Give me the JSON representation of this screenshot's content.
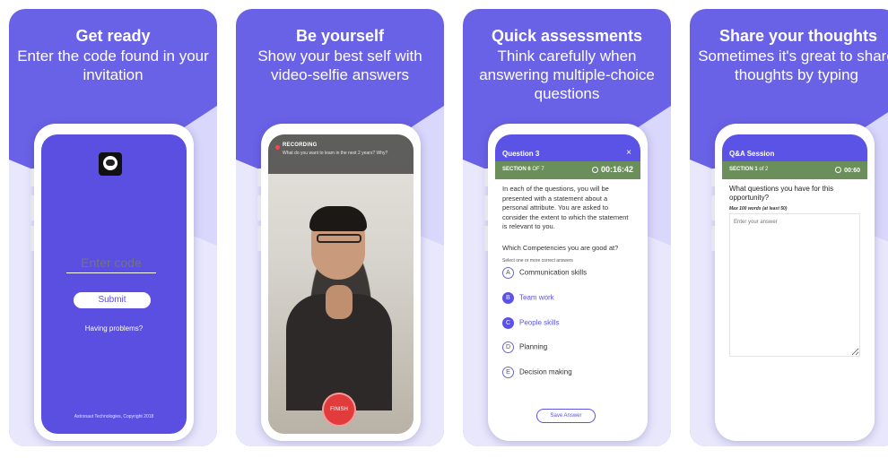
{
  "panels": [
    {
      "title": "Get ready",
      "subtitle": "Enter the code found in your invitation"
    },
    {
      "title": "Be yourself",
      "subtitle": "Show your best self with video-selfie answers"
    },
    {
      "title": "Quick assessments",
      "subtitle": "Think carefully when answering multiple-choice questions"
    },
    {
      "title": "Share your thoughts",
      "subtitle": "Sometimes it's great to share thoughts by typing"
    }
  ],
  "login": {
    "code_placeholder": "Enter code",
    "submit_label": "Submit",
    "problems_link": "Having problems?",
    "copyright": "Astronaut Technologies, Copyright 2018"
  },
  "recording": {
    "label": "RECORDING",
    "question": "What do you want to learn in the next 2 years? Why?",
    "finish_label": "FINISH"
  },
  "assessment": {
    "header_title": "Question 3",
    "close_glyph": "×",
    "section_word": "SECTION 6",
    "section_of": " OF 7",
    "timer": "00:16:42",
    "instructions": "In each of the questions, you will be presented with a statement about a personal attribute. You are asked to consider the extent to which the statement is relevant to you.",
    "question": "Which Competencies you are good at?",
    "hint": "Select one or more correct answers",
    "options": [
      {
        "letter": "A",
        "label": "Communication skills",
        "selected": false
      },
      {
        "letter": "B",
        "label": "Team work",
        "selected": true
      },
      {
        "letter": "C",
        "label": "People skills",
        "selected": true
      },
      {
        "letter": "D",
        "label": "Planning",
        "selected": false
      },
      {
        "letter": "E",
        "label": "Decision making",
        "selected": false
      }
    ],
    "save_label": "Save Answer"
  },
  "qa": {
    "header_title": "Q&A Session",
    "section_word": "SECTION 1",
    "section_of": " of 2",
    "timer": "00:60",
    "question": "What questions you have for this opportunity?",
    "hint": "Max 100 words (at least 50)",
    "answer_placeholder": "Enter your answer"
  },
  "colors": {
    "brand": "#6a62e6",
    "header": "#5b52e6",
    "section_bar": "#6b8f5a",
    "record": "#e23b3b"
  }
}
